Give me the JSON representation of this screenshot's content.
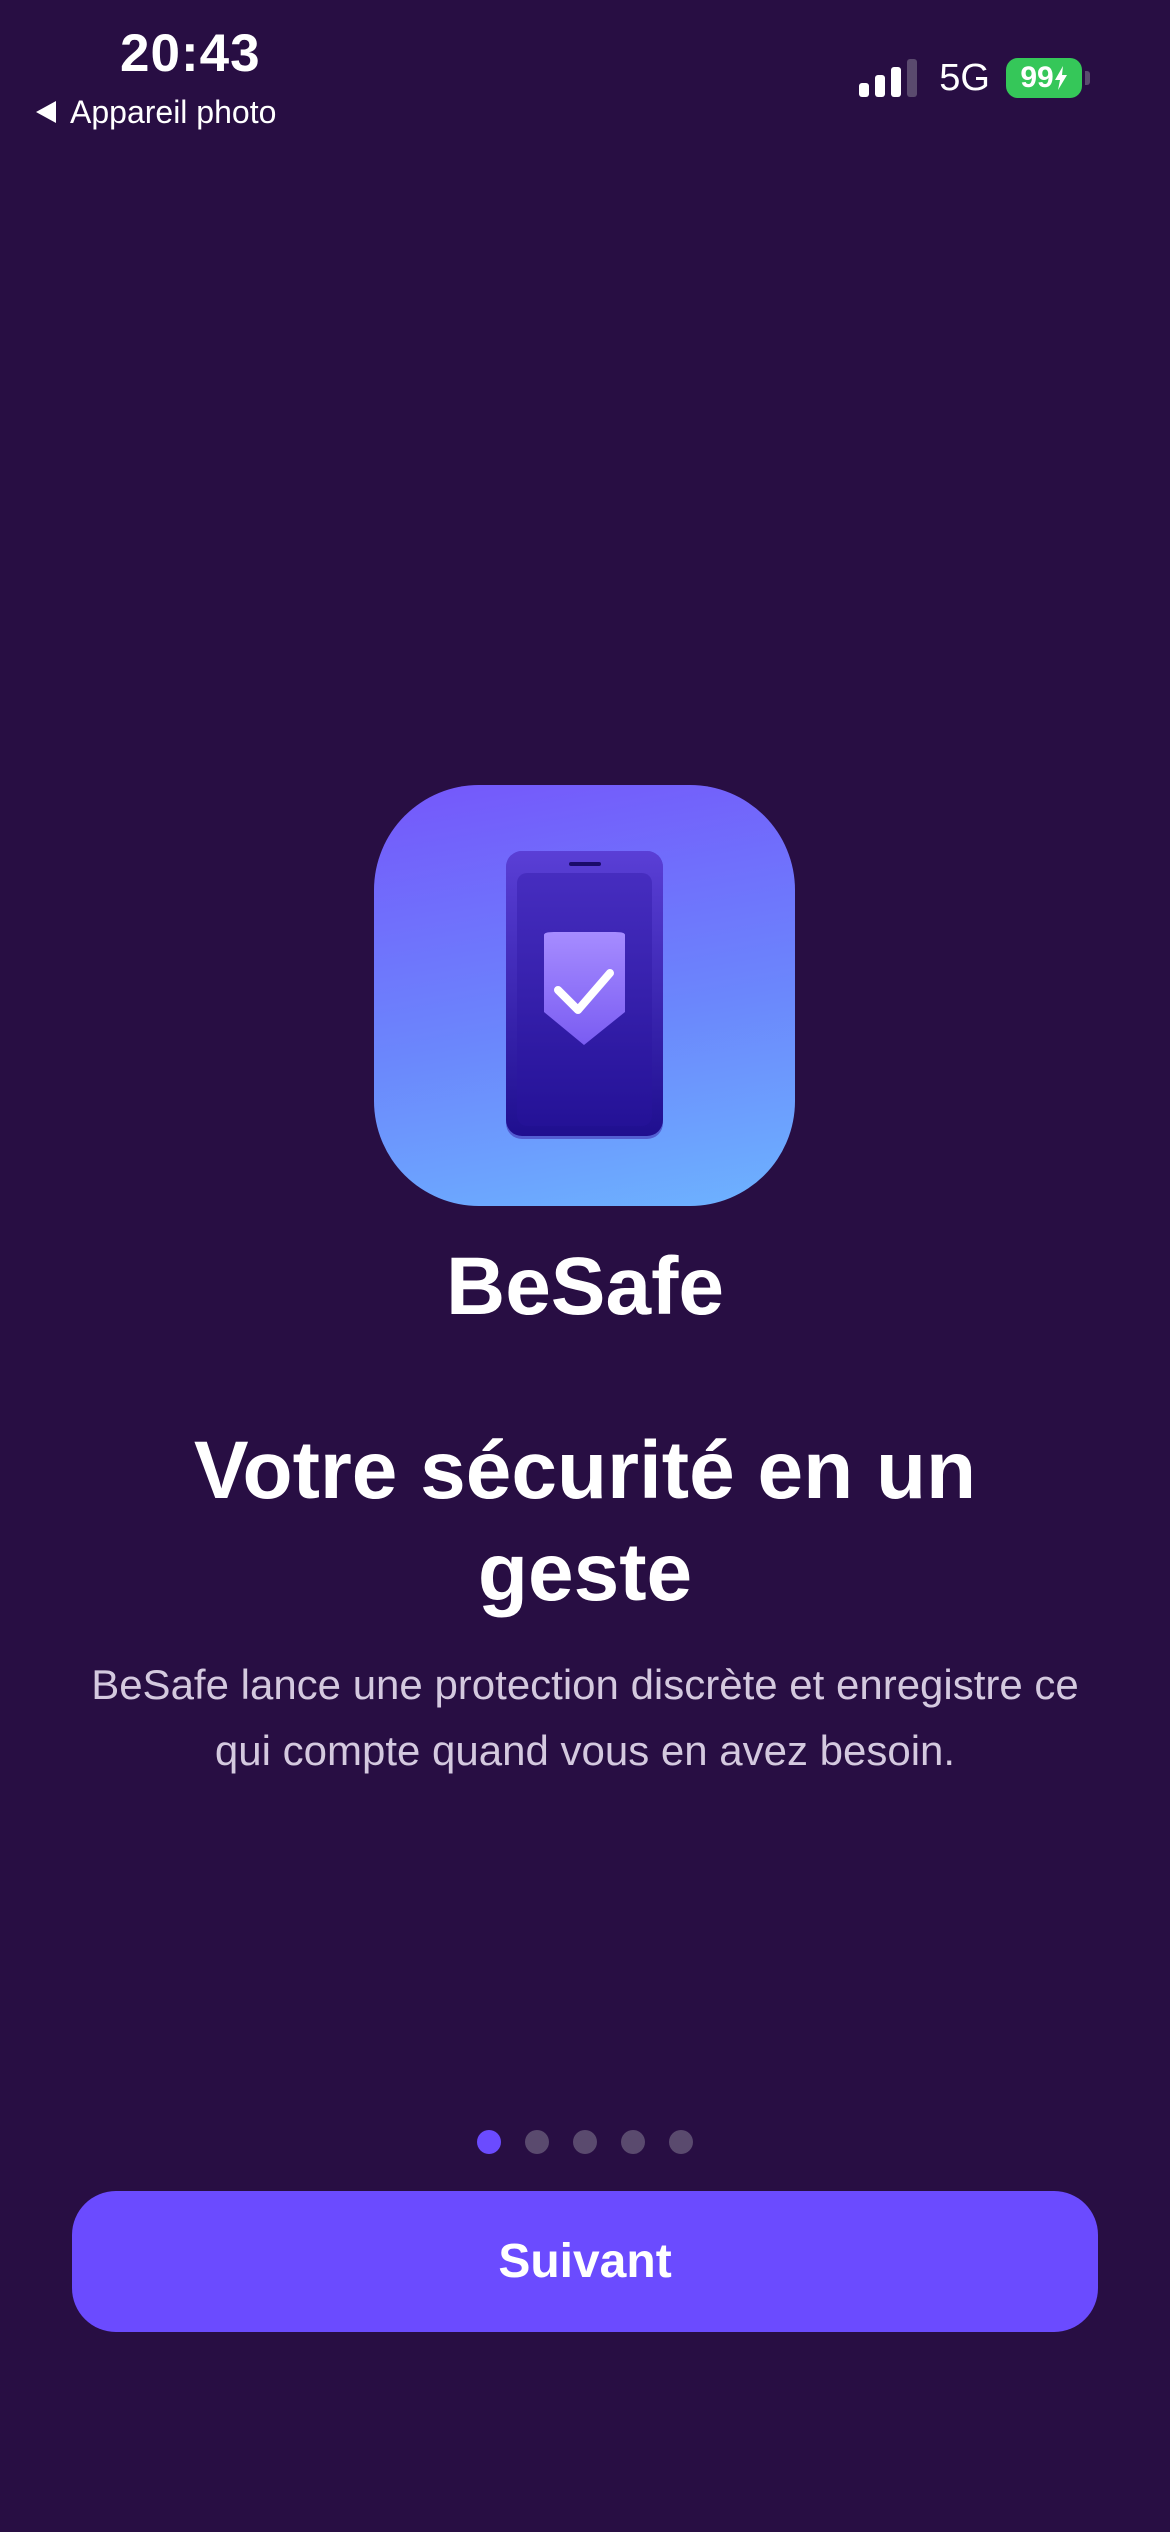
{
  "status_bar": {
    "time": "20:43",
    "back_label": "Appareil photo",
    "network": "5G",
    "battery": "99"
  },
  "app": {
    "name": "BeSafe",
    "icon": "phone-shield-check-icon"
  },
  "onboarding": {
    "headline": "Votre sécurité en un geste",
    "description": "BeSafe lance une protection discrète et enregistre ce qui compte quand vous en avez besoin.",
    "page_count": 5,
    "current_page": 1
  },
  "actions": {
    "next_label": "Suivant"
  },
  "colors": {
    "background": "#280e43",
    "accent": "#6b4bff",
    "battery": "#35c759",
    "description_text": "#d4c9df",
    "inactive_dot": "#5a4a6e"
  }
}
